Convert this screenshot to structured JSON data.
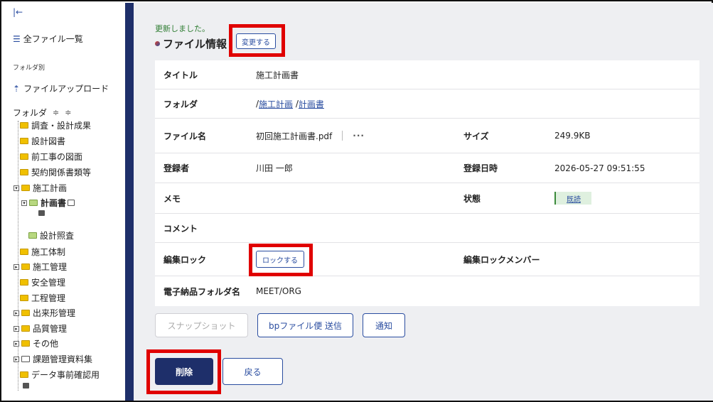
{
  "sidebar": {
    "collapse": "|←",
    "all_files": "全ファイル一覧",
    "folder_section": "フォルダ別",
    "upload": "ファイルアップロード",
    "folder_header": "フォルダ",
    "expand_all": "≑",
    "collapse_all": "≑",
    "tree": [
      {
        "label": "調査・設計成果"
      },
      {
        "label": "設計図書"
      },
      {
        "label": "前工事の図面"
      },
      {
        "label": "契約関係書類等"
      },
      {
        "label": "施工計画"
      },
      {
        "label": "計画書"
      },
      {
        "label": "設計照査"
      },
      {
        "label": "施工体制"
      },
      {
        "label": "施工管理"
      },
      {
        "label": "安全管理"
      },
      {
        "label": "工程管理"
      },
      {
        "label": "出来形管理"
      },
      {
        "label": "品質管理"
      },
      {
        "label": "その他"
      },
      {
        "label": "課題管理資料集"
      },
      {
        "label": "データ事前確認用"
      }
    ]
  },
  "main": {
    "updated_message": "更新しました。",
    "section_title": "ファイル情報",
    "change_button": "変更する",
    "rows": {
      "title_label": "タイトル",
      "title_value": "施工計画書",
      "folder_label": "フォルダ",
      "folder_path_1": "施工計画",
      "folder_path_2": "計画書",
      "filename_label": "ファイル名",
      "filename_value": "初回施工計画書.pdf",
      "more": "···",
      "size_label": "サイズ",
      "size_value": "249.9KB",
      "registrant_label": "登録者",
      "registrant_value": "川田 一郎",
      "registered_at_label": "登録日時",
      "registered_at_value": "2026-05-27 09:51:55",
      "memo_label": "メモ",
      "status_label": "状態",
      "status_value": "既読",
      "comment_label": "コメント",
      "lock_label": "編集ロック",
      "lock_button": "ロックする",
      "lock_member_label": "編集ロックメンバー",
      "delivery_folder_label": "電子納品フォルダ名",
      "delivery_folder_value": "MEET/ORG"
    },
    "buttons": {
      "snapshot": "スナップショット",
      "bp_send": "bpファイル便 送信",
      "notify": "通知",
      "delete": "削除",
      "back": "戻る"
    }
  }
}
